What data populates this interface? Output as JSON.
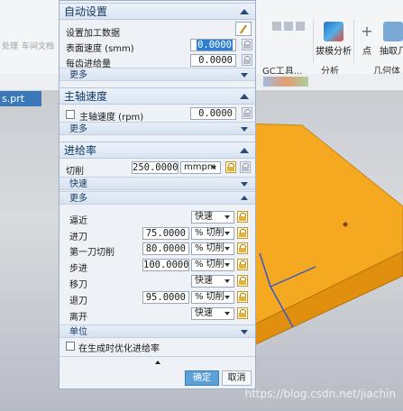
{
  "background": {
    "ribbon_left": [
      "处理",
      "车间文档"
    ],
    "ribbon_groups": [
      {
        "label": "拔模分析",
        "icon": "draft-analysis-icon"
      },
      {
        "label": "点",
        "icon": "point-icon"
      },
      {
        "label": "抽取几",
        "icon": "extract-geometry-icon"
      }
    ],
    "ribbon_sections": [
      "GC工具...",
      "分析",
      "几何体"
    ],
    "file_tab": "s.prt",
    "watermark": "https://blog.csdn.net/jiachin"
  },
  "dialog": {
    "auto": {
      "title": "自动设置",
      "set_cutting_data": "设置加工数据",
      "surface_speed_label": "表面速度 (smm)",
      "surface_speed_value": "0.0000",
      "feed_per_tooth_label": "每齿进给量",
      "feed_per_tooth_value": "0.0000",
      "more": "更多"
    },
    "spindle": {
      "title": "主轴速度",
      "speed_label": "主轴速度 (rpm)",
      "speed_value": "0.0000",
      "more": "更多"
    },
    "feed": {
      "title": "进给率",
      "cut_label": "切削",
      "cut_value": "250.0000",
      "cut_unit": "mmpm",
      "rapid": "快速",
      "more": "更多",
      "rows": [
        {
          "label": "逼近",
          "value": "",
          "unit": "快速"
        },
        {
          "label": "进刀",
          "value": "75.0000",
          "unit": "% 切削"
        },
        {
          "label": "第一刀切削",
          "value": "80.0000",
          "unit": "% 切削"
        },
        {
          "label": "步进",
          "value": "100.0000",
          "unit": "% 切削"
        },
        {
          "label": "移刀",
          "value": "",
          "unit": "快速"
        },
        {
          "label": "退刀",
          "value": "95.0000",
          "unit": "% 切削"
        },
        {
          "label": "离开",
          "value": "",
          "unit": "快速"
        }
      ],
      "units": "单位",
      "optimize": "在生成时优化进给率"
    },
    "ok": "确定",
    "cancel": "取消"
  }
}
